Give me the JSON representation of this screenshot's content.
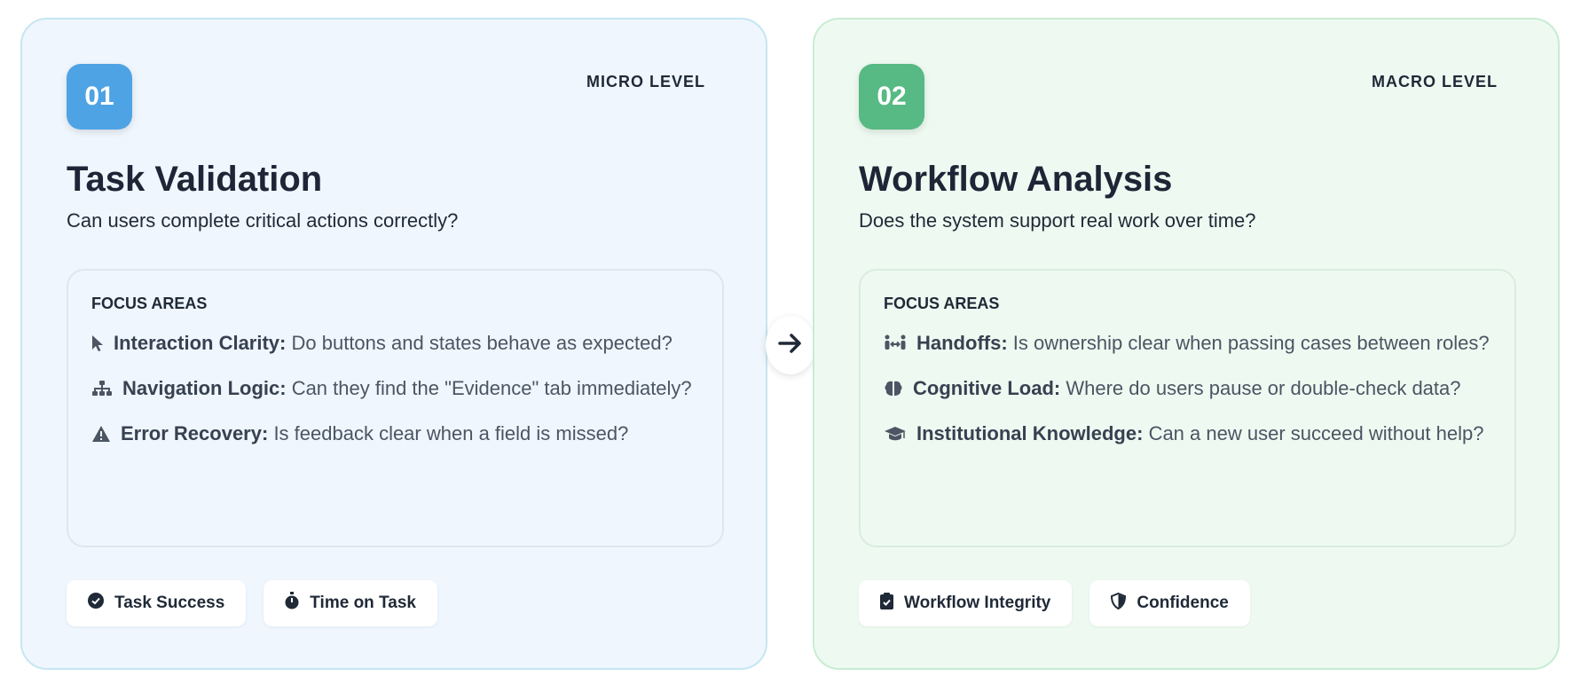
{
  "cards": [
    {
      "number": "01",
      "level": "MICRO LEVEL",
      "title": "Task Validation",
      "subtitle": "Can users complete critical actions correctly?",
      "focus_title": "FOCUS AREAS",
      "items": [
        {
          "icon": "cursor-icon",
          "label": "Interaction Clarity:",
          "text": "Do buttons and states behave as expected?"
        },
        {
          "icon": "sitemap-icon",
          "label": "Navigation Logic:",
          "text": "Can they find the \"Evidence\" tab immediately?"
        },
        {
          "icon": "warning-icon",
          "label": "Error Recovery:",
          "text": "Is feedback clear when a field is missed?"
        }
      ],
      "pills": [
        {
          "icon": "check-circle-icon",
          "label": "Task Success"
        },
        {
          "icon": "stopwatch-icon",
          "label": "Time on Task"
        }
      ],
      "accent": "#4da3e4"
    },
    {
      "number": "02",
      "level": "MACRO LEVEL",
      "title": "Workflow Analysis",
      "subtitle": "Does the system support real work over time?",
      "focus_title": "FOCUS AREAS",
      "items": [
        {
          "icon": "people-arrows-icon",
          "label": "Handoffs:",
          "text": "Is ownership clear when passing cases between roles?"
        },
        {
          "icon": "brain-icon",
          "label": "Cognitive Load:",
          "text": "Where do users pause or double-check data?"
        },
        {
          "icon": "graduation-cap-icon",
          "label": "Institutional Knowledge:",
          "text": "Can a new user succeed without help?"
        }
      ],
      "pills": [
        {
          "icon": "clipboard-check-icon",
          "label": "Workflow Integrity"
        },
        {
          "icon": "shield-icon",
          "label": "Confidence"
        }
      ],
      "accent": "#57b983"
    }
  ],
  "connector": {
    "icon": "arrow-right-icon"
  }
}
